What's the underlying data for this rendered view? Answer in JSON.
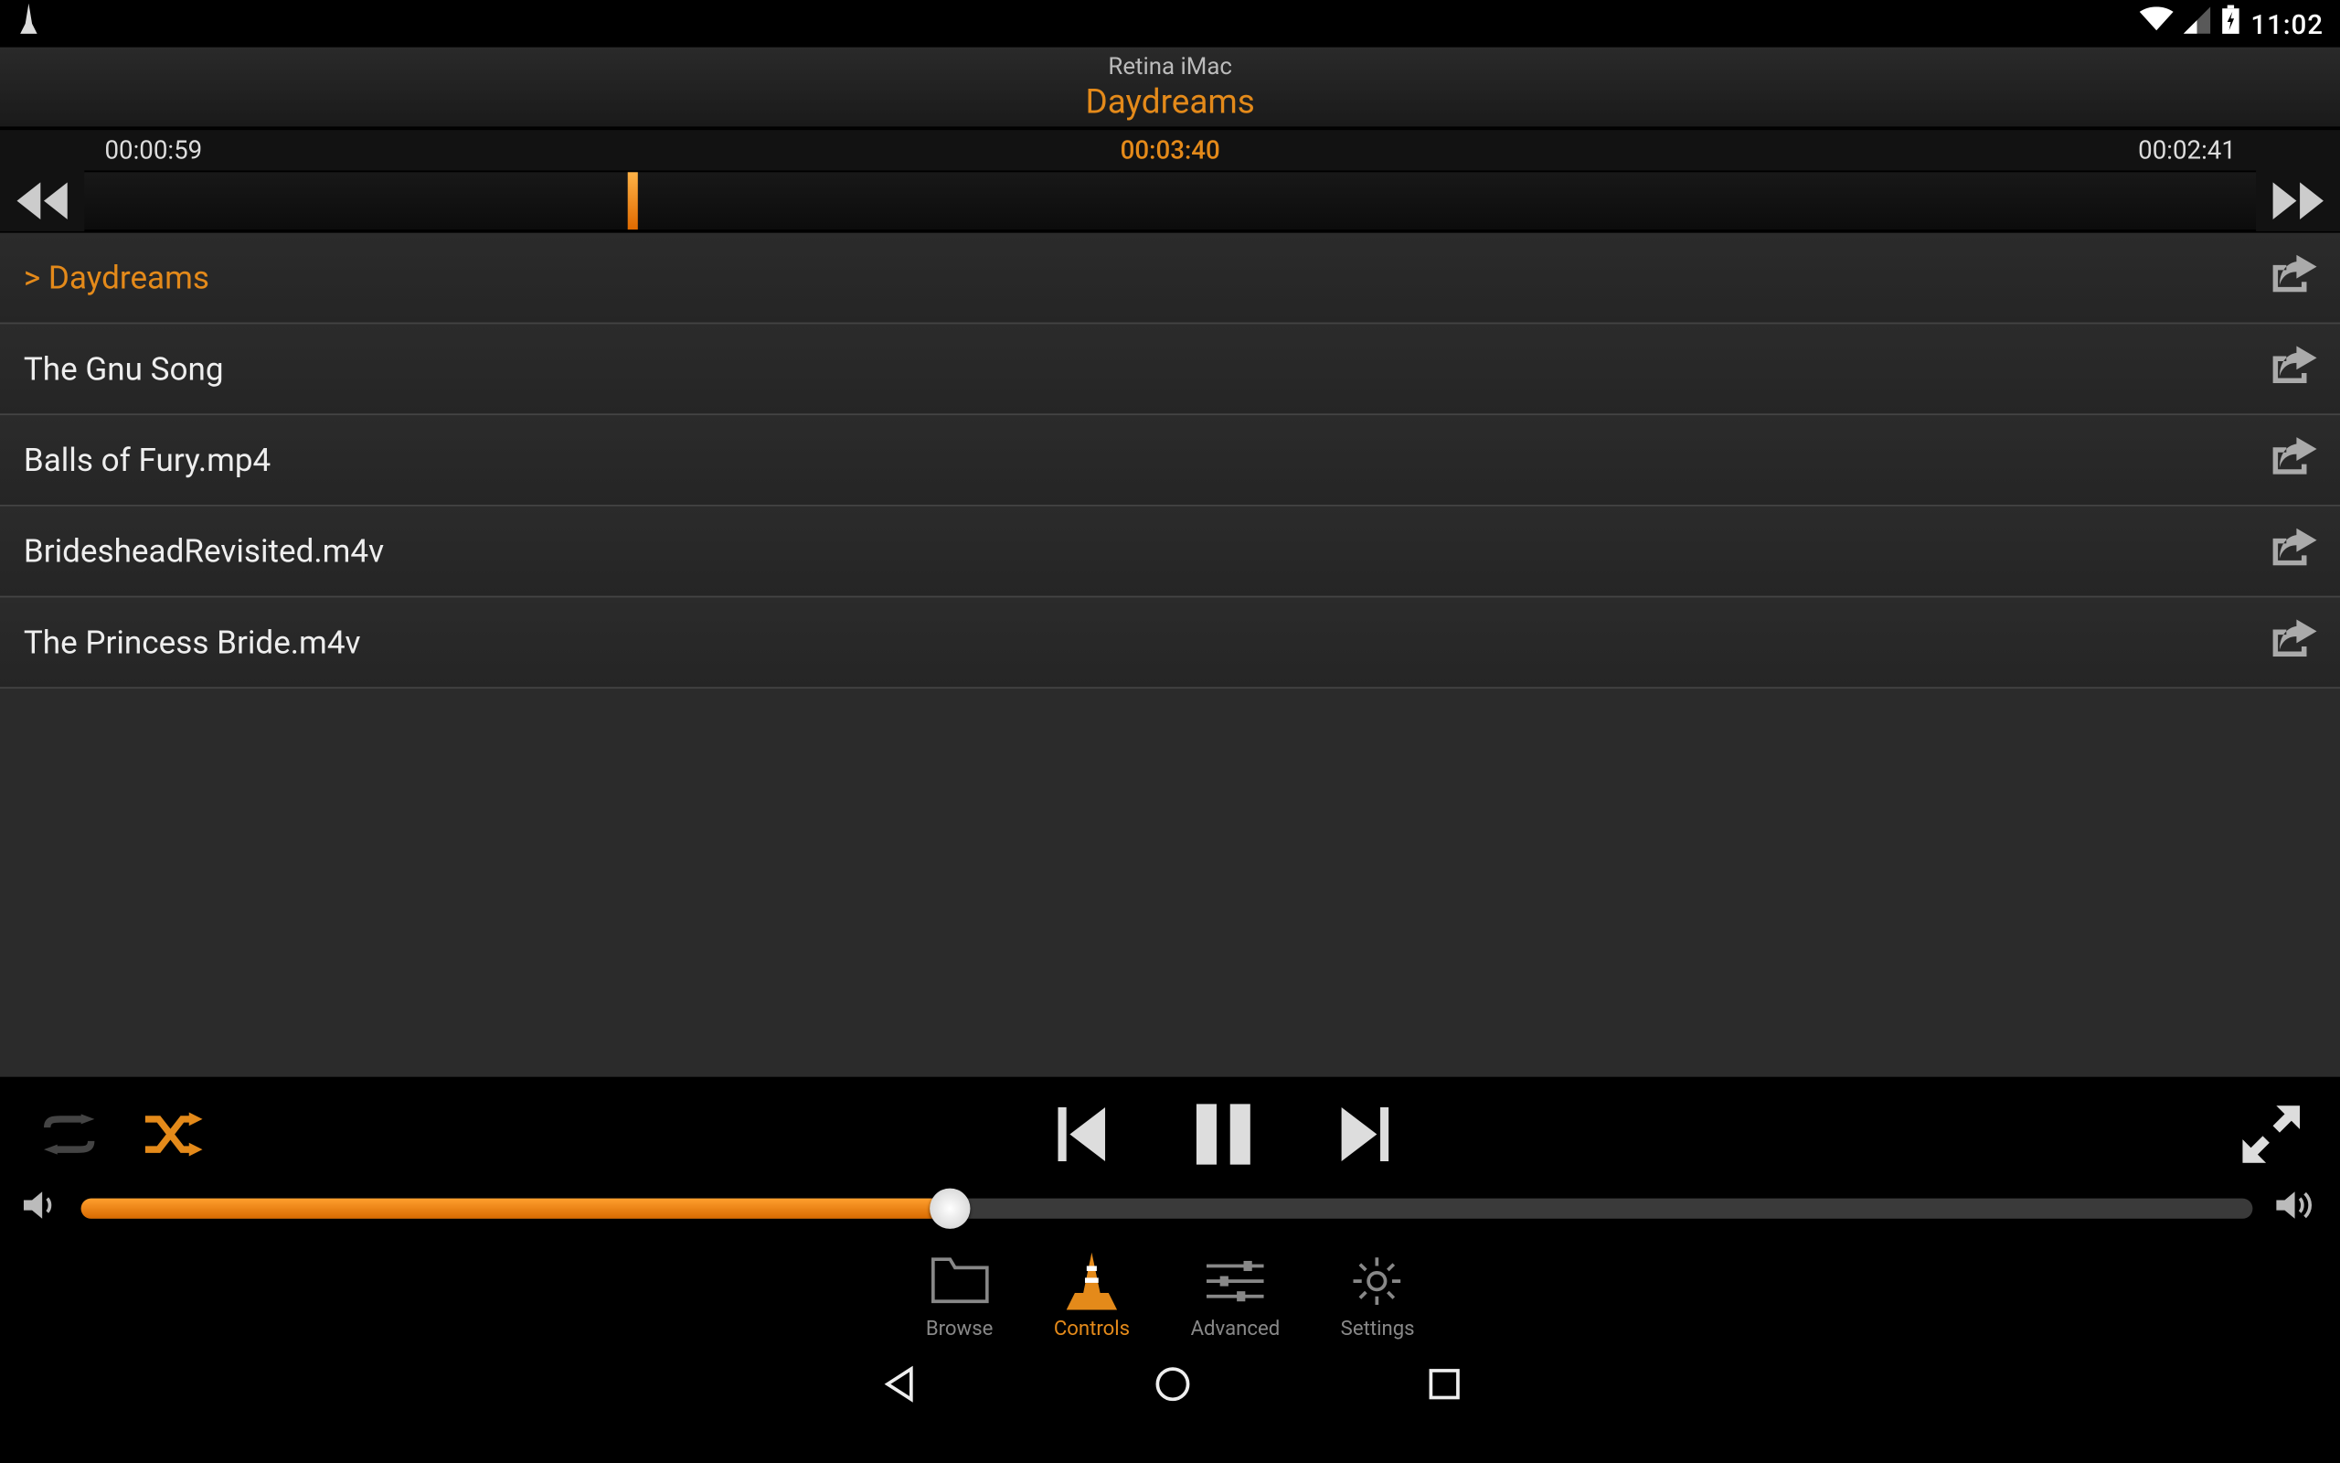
{
  "status": {
    "time": "11:02"
  },
  "header": {
    "device_name": "Retina iMac",
    "track_title": "Daydreams"
  },
  "seek": {
    "elapsed": "00:00:59",
    "total": "00:03:40",
    "remaining": "00:02:41",
    "progress_pct": 25
  },
  "playlist": [
    {
      "label": "> Daydreams",
      "active": true
    },
    {
      "label": "The Gnu Song",
      "active": false
    },
    {
      "label": "Balls of Fury.mp4",
      "active": false
    },
    {
      "label": "BridesheadRevisited.m4v",
      "active": false
    },
    {
      "label": "The Princess Bride.m4v",
      "active": false
    }
  ],
  "controls": {
    "repeat_on": false,
    "shuffle_on": true,
    "playing": true
  },
  "volume": {
    "percent": 40
  },
  "tabs": {
    "items": [
      {
        "label": "Browse",
        "active": false
      },
      {
        "label": "Controls",
        "active": true
      },
      {
        "label": "Advanced",
        "active": false
      },
      {
        "label": "Settings",
        "active": false
      }
    ]
  },
  "colors": {
    "accent": "#e48a1a"
  }
}
